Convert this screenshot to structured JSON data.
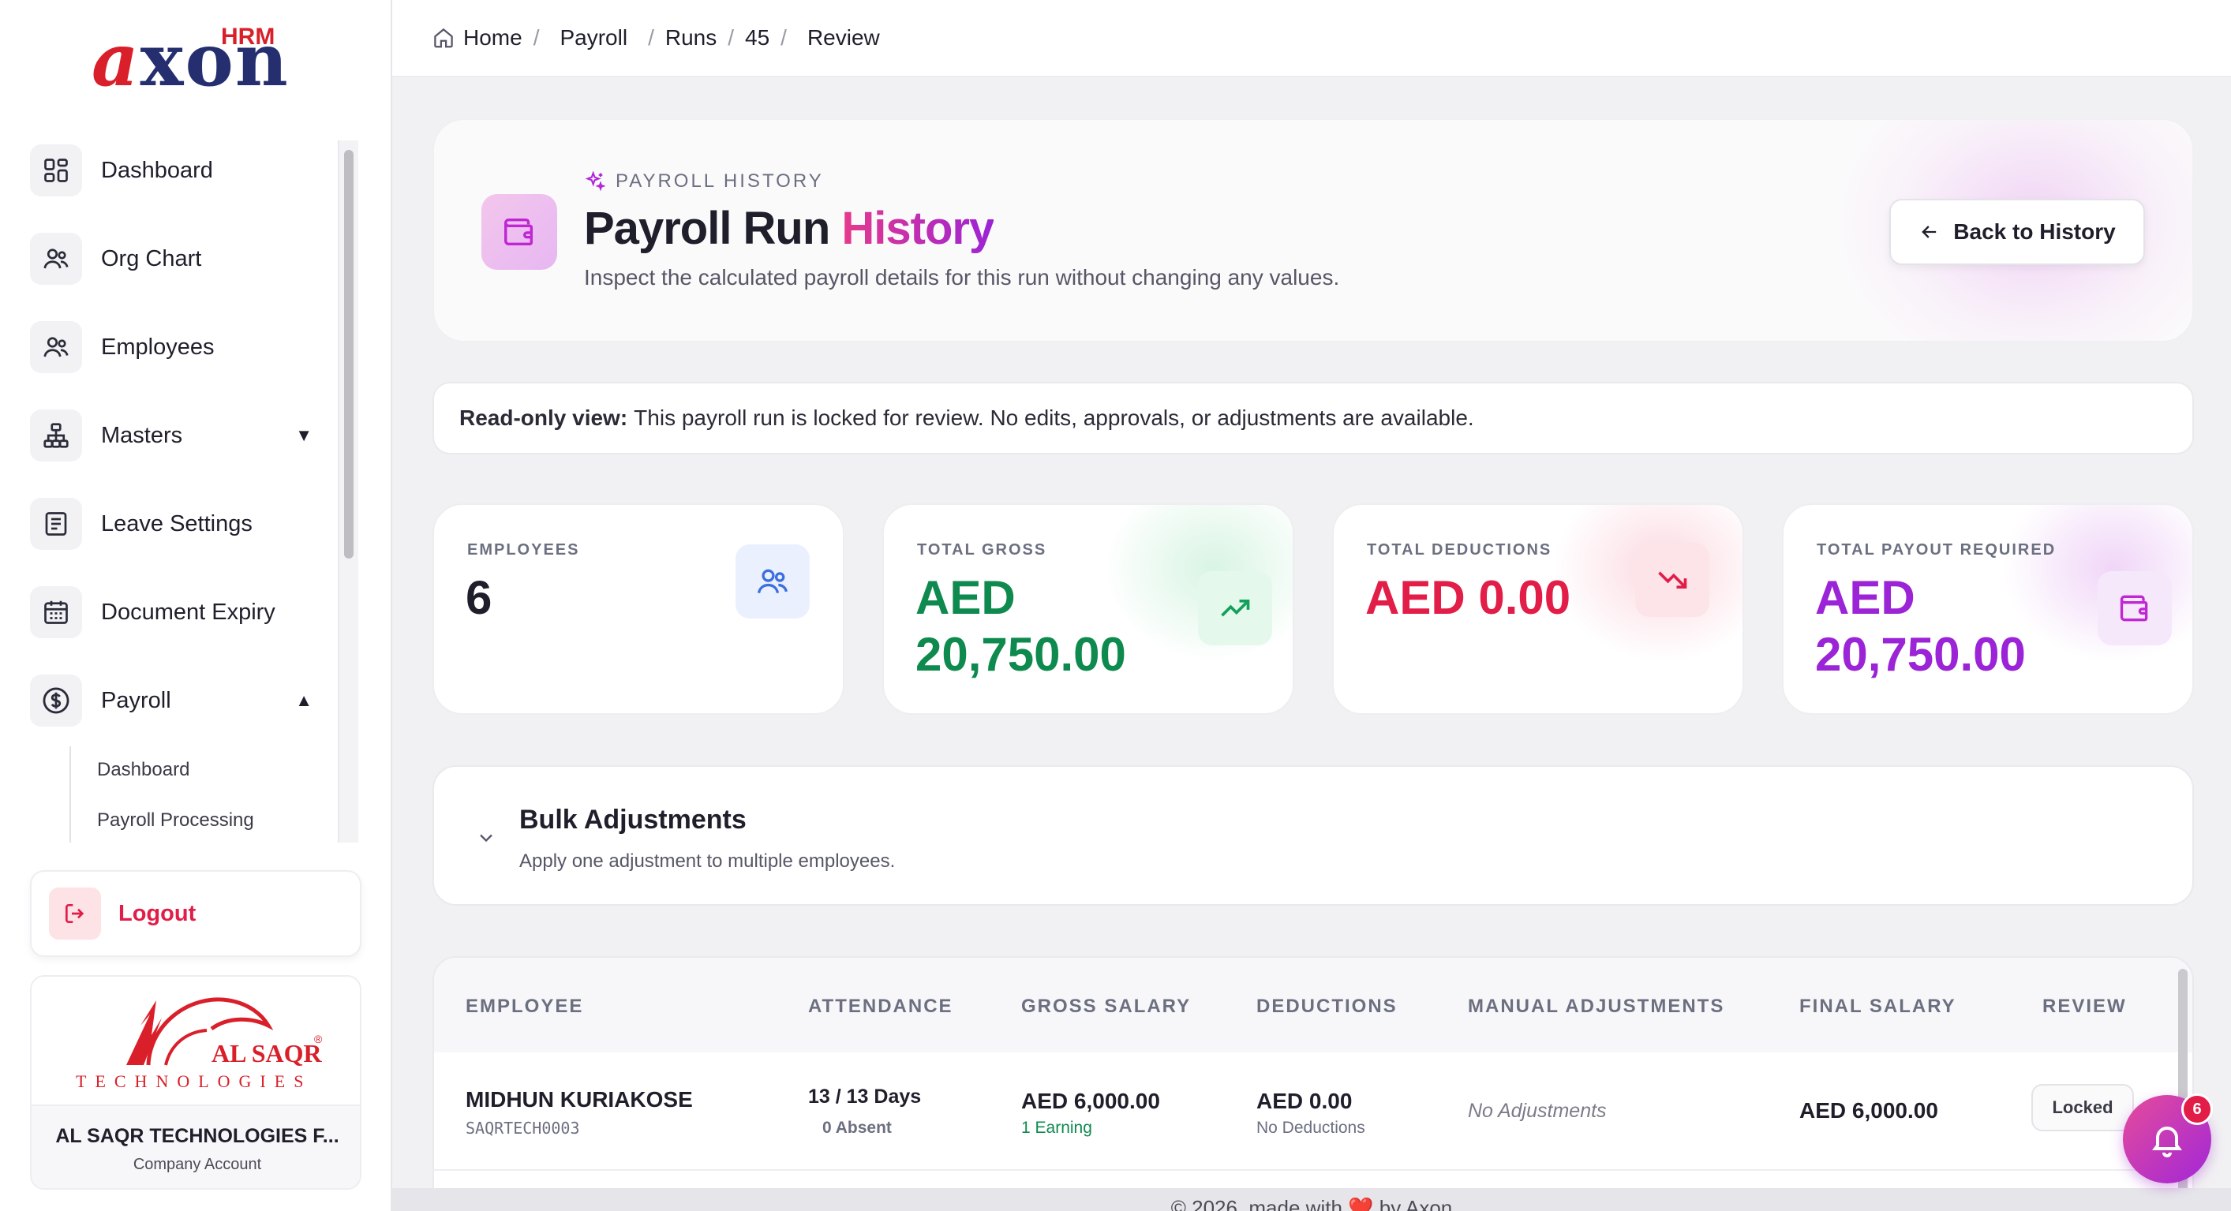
{
  "brand": {
    "name": "axon",
    "tag": "HRM"
  },
  "breadcrumb": {
    "home": "Home",
    "items": [
      "Payroll",
      "Runs",
      "45",
      "Review"
    ]
  },
  "sidebar": {
    "items": [
      {
        "label": "Dashboard",
        "icon": "dashboard-icon"
      },
      {
        "label": "Org Chart",
        "icon": "org-chart-icon"
      },
      {
        "label": "Employees",
        "icon": "employees-icon"
      },
      {
        "label": "Masters",
        "icon": "masters-icon",
        "caret": "▼"
      },
      {
        "label": "Leave Settings",
        "icon": "document-icon"
      },
      {
        "label": "Document Expiry",
        "icon": "calendar-icon"
      },
      {
        "label": "Payroll",
        "icon": "dollar-icon",
        "caret": "▲"
      }
    ],
    "subitems": [
      "Dashboard",
      "Payroll Processing"
    ],
    "logout": "Logout",
    "company": {
      "logo_text": "AL SAQR",
      "logo_reg": "®",
      "logo_sub": "TECHNOLOGIES",
      "name": "AL SAQR TECHNOLOGIES F...",
      "type": "Company Account"
    }
  },
  "hero": {
    "kicker": "PAYROLL HISTORY",
    "title_a": "Payroll Run",
    "title_b": "History",
    "subtitle": "Inspect the calculated payroll details for this run without changing any values.",
    "back_button": "Back to History"
  },
  "notice": {
    "bold": "Read-only view:",
    "text": "This payroll run is locked for review. No edits, approvals, or adjustments are available."
  },
  "stats": [
    {
      "label": "EMPLOYEES",
      "value_line1": "6",
      "value_line2": "",
      "color": "#1e1f2b"
    },
    {
      "label": "TOTAL GROSS",
      "value_line1": "AED",
      "value_line2": "20,750.00",
      "color": "#0f8a4f"
    },
    {
      "label": "TOTAL DEDUCTIONS",
      "value_line1": "AED 0.00",
      "value_line2": "",
      "color": "#e11d48"
    },
    {
      "label": "TOTAL PAYOUT REQUIRED",
      "value_line1": "AED",
      "value_line2": "20,750.00",
      "color": "#9b24d6"
    }
  ],
  "bulk": {
    "title": "Bulk Adjustments",
    "subtitle": "Apply one adjustment to multiple employees."
  },
  "table": {
    "headers": [
      "EMPLOYEE",
      "ATTENDANCE",
      "GROSS SALARY",
      "DEDUCTIONS",
      "MANUAL ADJUSTMENTS",
      "FINAL SALARY",
      "REVIEW"
    ],
    "rows": [
      {
        "name": "MIDHUN KURIAKOSE",
        "code": "SAQRTECH0003",
        "attendance": "13 / 13 Days",
        "absent": "0 Absent",
        "gross": "AED 6,000.00",
        "gross_sub": "1 Earning",
        "deductions": "AED 0.00",
        "deductions_sub": "No Deductions",
        "adjustments": "No Adjustments",
        "final": "AED 6,000.00",
        "review": "Locked"
      }
    ]
  },
  "footer": {
    "pre": "© 2026, made with",
    "heart": "❤️",
    "post": "by Axon"
  },
  "notifications": {
    "count": "6"
  }
}
